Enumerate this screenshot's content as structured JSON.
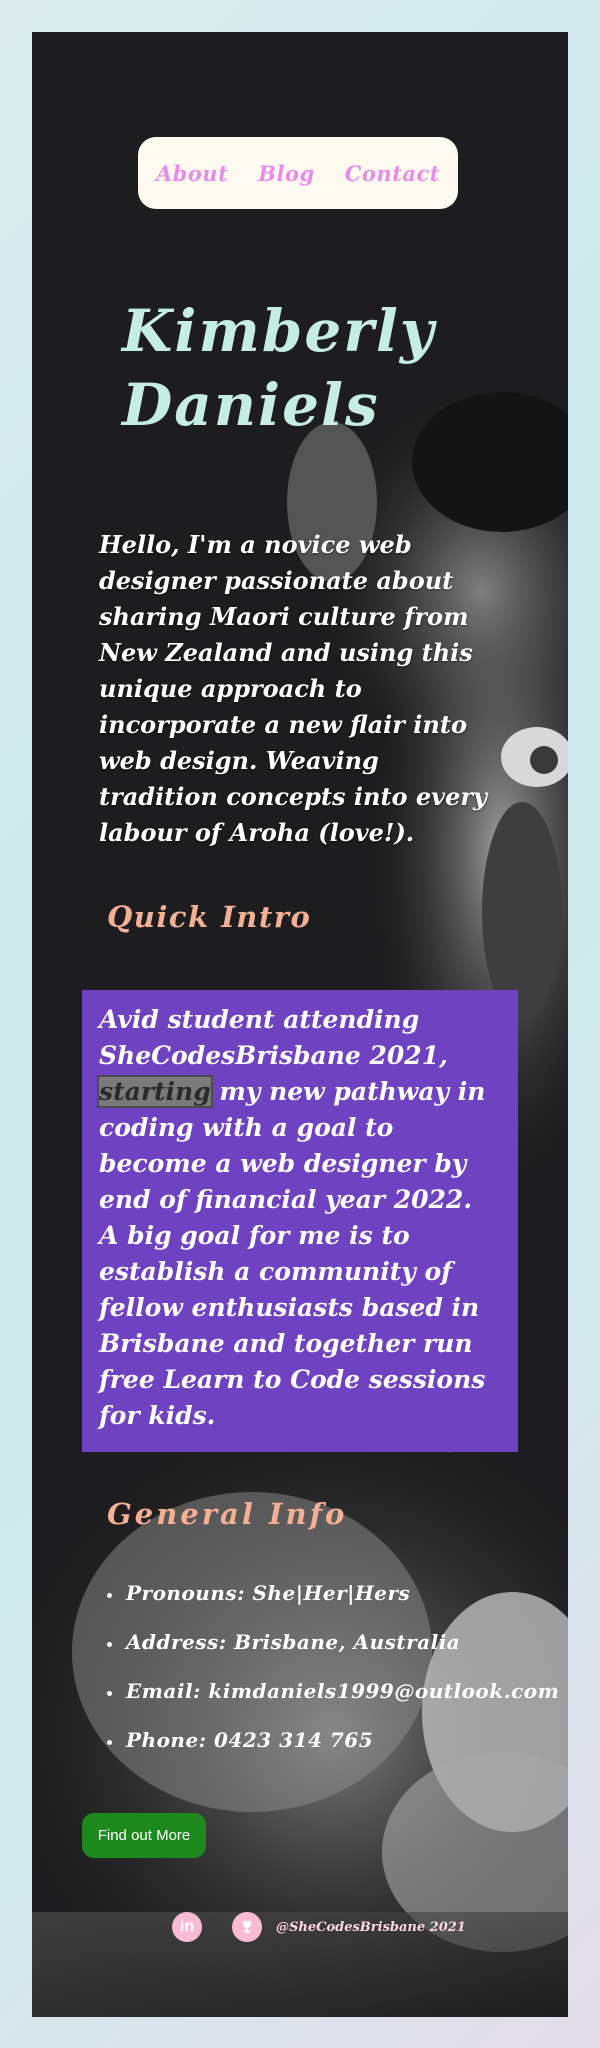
{
  "nav": {
    "items": [
      "About",
      "Blog",
      "Contact"
    ]
  },
  "hero": {
    "name_line1": "Kimberly",
    "name_line2": "Daniels",
    "intro": "Hello, I'm a novice web designer passionate about sharing Maori culture from New Zealand and using this unique approach to incorporate a new flair into web design. Weaving tradition concepts into every labour of Aroha (love!)."
  },
  "quick_intro": {
    "title": "Quick Intro",
    "text_before": "Avid student attending SheCodesBrisbane 2021, ",
    "text_highlight": "starting",
    "text_after": " my new pathway in coding with a goal to become a web designer by end of financial year 2022. A big goal for me is to establish a community of fellow enthusiasts based in Brisbane and together run free Learn to Code sessions for kids."
  },
  "general_info": {
    "title": "General Info",
    "items": [
      "Pronouns: She|Her|Hers",
      "Address: Brisbane, Australia",
      "Email: kimdaniels1999@outlook.com",
      "Phone: 0423 314 765"
    ]
  },
  "cta": {
    "label": "Find out More"
  },
  "footer": {
    "credit": "@SheCodesBrisbane 2021",
    "icons": [
      "linkedin-icon",
      "trophy-icon"
    ]
  },
  "colors": {
    "nav_link": "#e58de8",
    "name": "#c6ece6",
    "section_title": "#f4b095",
    "quick_box": "#6f42c1",
    "button": "#1e8a1e",
    "social_icon": "#f7bcd4"
  }
}
